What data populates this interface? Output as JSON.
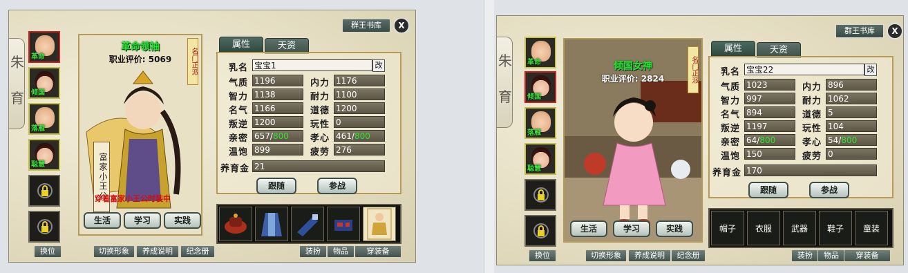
{
  "panels": [
    {
      "library_button": "群王书库",
      "close_label": "X",
      "scroll_glyphs": [
        "朱",
        "育"
      ],
      "slots": [
        {
          "label": "革命",
          "type": "bald"
        },
        {
          "label": "倾国",
          "type": "girl"
        },
        {
          "label": "落雁",
          "type": "bald"
        },
        {
          "label": "聪慧",
          "type": "girl"
        }
      ],
      "swap_button": "换位",
      "portrait": {
        "title": "革命领袖",
        "score_text": "职业评价: 5069",
        "side_tag": "名门正派",
        "name_scroll": "富家小王公",
        "note": "穿着富家小王公时装中"
      },
      "actions": [
        "生活",
        "学习",
        "实践"
      ],
      "bottom_buttons": [
        "切换形象",
        "养成说明",
        "纪念册"
      ],
      "tabs": [
        "属性",
        "天资"
      ],
      "stats": {
        "name_label": "乳名",
        "name_value": "宝宝1",
        "edit_label": "改",
        "rows": [
          {
            "l1": "气质",
            "v1": "1196",
            "l2": "内力",
            "v2": "1176"
          },
          {
            "l1": "智力",
            "v1": "1138",
            "l2": "耐力",
            "v2": "1100"
          },
          {
            "l1": "名气",
            "v1": "1166",
            "l2": "道德",
            "v2": "1200"
          },
          {
            "l1": "叛逆",
            "v1": "1200",
            "l2": "玩性",
            "v2": "0"
          },
          {
            "l1": "亲密",
            "v1": "657/",
            "v1b": "800",
            "l2": "孝心",
            "v2": "461/",
            "v2b": "800"
          },
          {
            "l1": "温饱",
            "v1": "899",
            "l2": "疲劳",
            "v2": "276"
          }
        ],
        "raiser_label": "养育金",
        "raiser_value": "21"
      },
      "follow_button": "跟随",
      "battle_button": "参战",
      "equip_labels": [],
      "equip_buttons": [
        "装扮",
        "物品",
        "穿装备"
      ]
    },
    {
      "library_button": "群王书库",
      "close_label": "X",
      "scroll_glyphs": [
        "朱",
        "育"
      ],
      "slots": [
        {
          "label": "革命",
          "type": "bald"
        },
        {
          "label": "倾国",
          "type": "girl"
        },
        {
          "label": "落雁",
          "type": "bald"
        },
        {
          "label": "聪慧",
          "type": "girl"
        }
      ],
      "swap_button": "换位",
      "portrait": {
        "title": "倾国女神",
        "score_text": "职业评价: 2824",
        "side_tag": "名门正派",
        "name_scroll": "",
        "note": ""
      },
      "actions": [
        "生活",
        "学习",
        "实践"
      ],
      "bottom_buttons": [
        "切换形象",
        "养成说明",
        "纪念册"
      ],
      "tabs": [
        "属性",
        "天资"
      ],
      "stats": {
        "name_label": "乳名",
        "name_value": "宝宝22",
        "edit_label": "改",
        "rows": [
          {
            "l1": "气质",
            "v1": "1023",
            "l2": "内力",
            "v2": "896"
          },
          {
            "l1": "智力",
            "v1": "997",
            "l2": "耐力",
            "v2": "1062"
          },
          {
            "l1": "名气",
            "v1": "894",
            "l2": "道德",
            "v2": "5"
          },
          {
            "l1": "叛逆",
            "v1": "1197",
            "l2": "玩性",
            "v2": "104"
          },
          {
            "l1": "亲密",
            "v1": "64/",
            "v1b": "800",
            "l2": "孝心",
            "v2": "54/",
            "v2b": "800"
          },
          {
            "l1": "温饱",
            "v1": "150",
            "l2": "疲劳",
            "v2": "0"
          }
        ],
        "raiser_label": "养育金",
        "raiser_value": "170"
      },
      "follow_button": "跟随",
      "battle_button": "参战",
      "equip_labels": [
        "帽子",
        "衣服",
        "武器",
        "鞋子",
        "童装"
      ],
      "equip_buttons": [
        "装扮",
        "物品",
        "穿装备"
      ]
    }
  ]
}
